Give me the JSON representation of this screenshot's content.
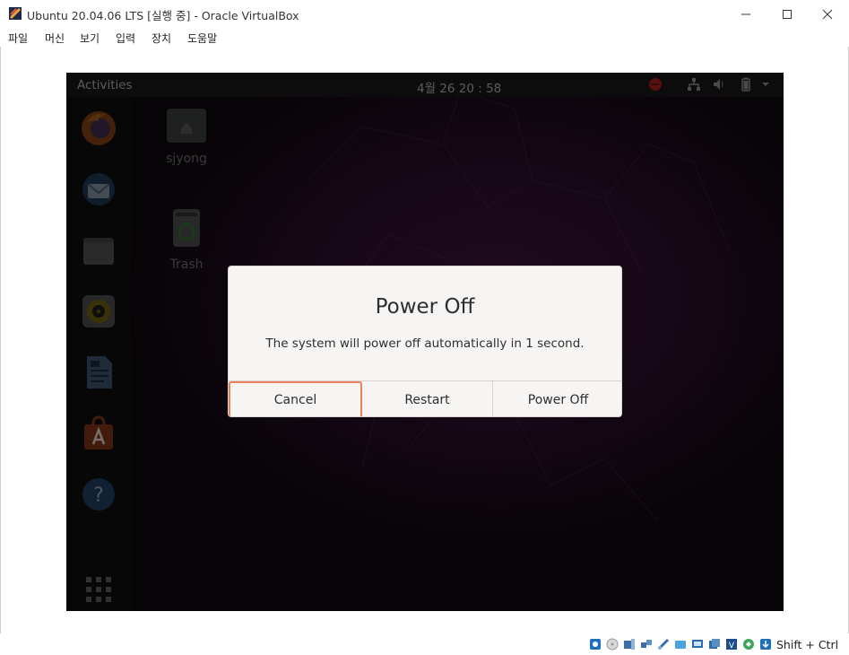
{
  "window": {
    "title": "Ubuntu 20.04.06 LTS [실행 중] - Oracle VirtualBox",
    "controls": {
      "minimize": "—",
      "maximize": "☐",
      "close": "✕"
    }
  },
  "menubar": {
    "items": [
      "파일",
      "머신",
      "보기",
      "입력",
      "장치",
      "도움말"
    ]
  },
  "gnome": {
    "activities": "Activities",
    "clock": "4월 26  20 : 58",
    "tray_icons": [
      "stop-icon",
      "network-icon",
      "volume-icon",
      "battery-icon",
      "dropdown-arrow-icon"
    ]
  },
  "dock": {
    "apps": [
      "firefox-icon",
      "thunderbird-icon",
      "files-icon",
      "rhythmbox-icon",
      "libreoffice-writer-icon",
      "ubuntu-software-icon",
      "help-icon",
      "show-applications-icon"
    ]
  },
  "desktop": {
    "icons": [
      {
        "label": "sjyong",
        "icon": "home-folder-icon"
      },
      {
        "label": "Trash",
        "icon": "trash-icon"
      }
    ]
  },
  "dialog": {
    "title": "Power Off",
    "message": "The system will power off automatically in 1 second.",
    "buttons": {
      "cancel": "Cancel",
      "restart": "Restart",
      "power_off": "Power Off"
    }
  },
  "statusbar": {
    "host_key": "Shift + Ctrl",
    "icons": [
      "hard-disk-icon",
      "optical-drive-icon",
      "audio-icon",
      "network-adapter-icon",
      "usb-icon",
      "shared-folders-icon",
      "display-icon",
      "recording-icon",
      "virtualization-icon",
      "mouse-integration-icon",
      "keyboard-capture-icon"
    ]
  }
}
